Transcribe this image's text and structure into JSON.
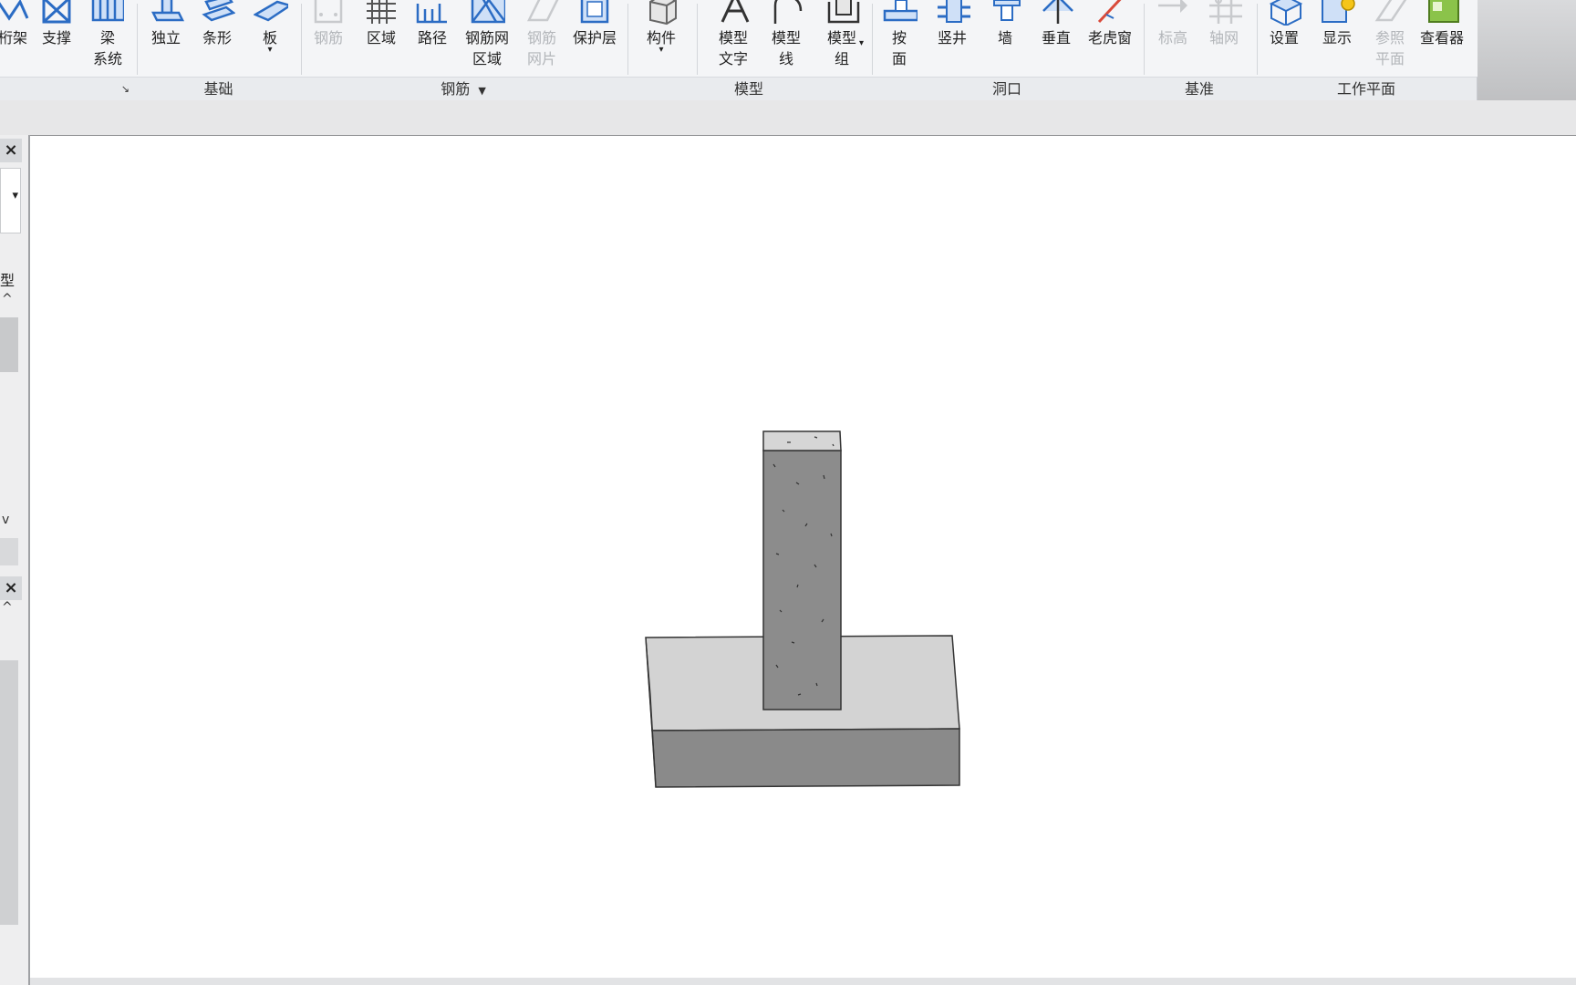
{
  "ribbon": {
    "buttons": [
      {
        "name": "truss-button",
        "label": "桁架",
        "icon": "truss-icon",
        "disabled": false
      },
      {
        "name": "brace-button",
        "label": "支撑",
        "icon": "brace-icon",
        "disabled": false
      },
      {
        "name": "beam-system-button",
        "label": "梁",
        "label2": "系统",
        "icon": "beam-system-icon",
        "disabled": false
      },
      {
        "name": "isolated-foundation-button",
        "label": "独立",
        "icon": "isolated-foundation-icon",
        "disabled": false
      },
      {
        "name": "wall-foundation-button",
        "label": "条形",
        "icon": "wall-foundation-icon",
        "disabled": false
      },
      {
        "name": "slab-foundation-button",
        "label": "板",
        "icon": "slab-foundation-icon",
        "disabled": false,
        "dropdown": true
      },
      {
        "name": "rebar-button",
        "label": "钢筋",
        "icon": "rebar-icon",
        "disabled": true
      },
      {
        "name": "area-reinforcement-button",
        "label": "区域",
        "icon": "area-icon",
        "disabled": false
      },
      {
        "name": "path-reinforcement-button",
        "label": "路径",
        "icon": "path-icon",
        "disabled": false
      },
      {
        "name": "fabric-area-button",
        "label": "钢筋网",
        "label2": "区域",
        "icon": "fabric-area-icon",
        "disabled": false
      },
      {
        "name": "fabric-sheet-button",
        "label": "钢筋",
        "label2": "网片",
        "icon": "fabric-sheet-icon",
        "disabled": true
      },
      {
        "name": "cover-button",
        "label": "保护层",
        "icon": "cover-icon",
        "disabled": false
      },
      {
        "name": "component-button",
        "label": "构件",
        "icon": "component-icon",
        "disabled": false,
        "dropdown": true
      },
      {
        "name": "model-text-button",
        "label": "模型",
        "label2": "文字",
        "icon": "model-text-icon",
        "disabled": false
      },
      {
        "name": "model-line-button",
        "label": "模型",
        "label2": "线",
        "icon": "model-line-icon",
        "disabled": false
      },
      {
        "name": "model-group-button",
        "label": "模型",
        "label2": "组",
        "icon": "model-group-icon",
        "disabled": false,
        "dropdown": true
      },
      {
        "name": "by-face-button",
        "label": "按",
        "label2": "面",
        "icon": "by-face-icon",
        "disabled": false
      },
      {
        "name": "shaft-button",
        "label": "竖井",
        "icon": "shaft-icon",
        "disabled": false
      },
      {
        "name": "wall-opening-button",
        "label": "墙",
        "icon": "wall-opening-icon",
        "disabled": false
      },
      {
        "name": "vertical-opening-button",
        "label": "垂直",
        "icon": "vertical-icon",
        "disabled": false
      },
      {
        "name": "dormer-button",
        "label": "老虎窗",
        "icon": "dormer-icon",
        "disabled": false
      },
      {
        "name": "level-button",
        "label": "标高",
        "icon": "level-icon",
        "disabled": true
      },
      {
        "name": "grid-button",
        "label": "轴网",
        "icon": "grid-icon",
        "disabled": true
      },
      {
        "name": "set-workplane-button",
        "label": "设置",
        "icon": "set-icon",
        "disabled": false
      },
      {
        "name": "show-workplane-button",
        "label": "显示",
        "icon": "show-icon",
        "disabled": false
      },
      {
        "name": "ref-plane-button",
        "label": "参照",
        "label2": "平面",
        "icon": "ref-plane-icon",
        "disabled": true
      },
      {
        "name": "viewer-button",
        "label": "查看器",
        "icon": "viewer-icon",
        "disabled": false
      }
    ],
    "panels": {
      "structure_arrow": "↘",
      "foundation": "基础",
      "reinforcement": "钢筋",
      "reinforcement_arrow": "▼",
      "model": "模型",
      "opening": "洞口",
      "datum": "基准",
      "workplane": "工作平面"
    }
  },
  "left_panel": {
    "close_label": "×",
    "type_label": "型",
    "dropdown_arrow": "▾",
    "scroll_up": "^",
    "scroll_down": "v"
  },
  "colors": {
    "accent": "#2b6cc4",
    "concrete_light": "#d3d3d3",
    "concrete_dark": "#8a8a8a",
    "column_face": "#8c8c8c"
  }
}
